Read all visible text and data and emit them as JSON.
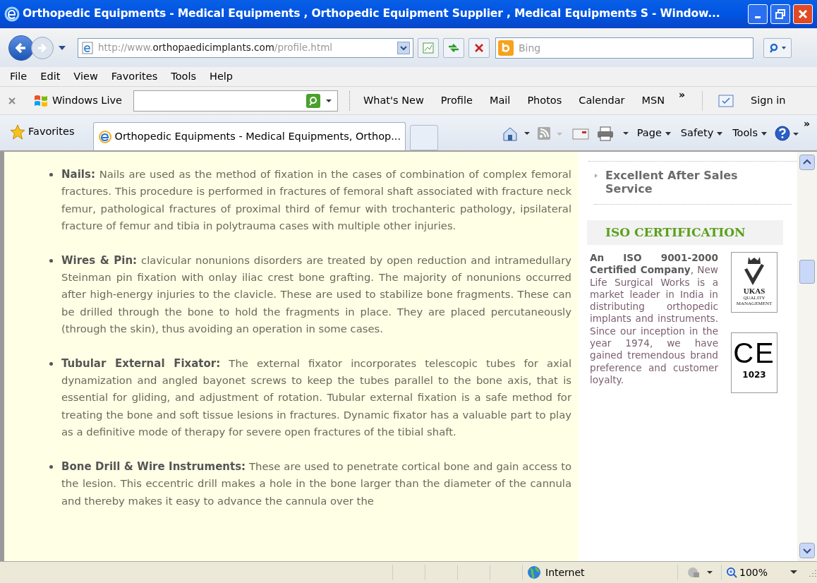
{
  "window": {
    "title": "Orthopedic Equipments - Medical Equipments , Orthopedic Equipment Supplier , Medical Equipments S - Window..."
  },
  "address": {
    "prefix": "http://www.",
    "domain": "orthopaedicimplants.com",
    "path": "/profile.html"
  },
  "search": {
    "placeholder": "Bing"
  },
  "menu": [
    "File",
    "Edit",
    "View",
    "Favorites",
    "Tools",
    "Help"
  ],
  "links_toolbar": {
    "brand": "Windows Live",
    "links": [
      "What's New",
      "Profile",
      "Mail",
      "Photos",
      "Calendar",
      "MSN"
    ],
    "more": "»",
    "sign_in": "Sign in"
  },
  "favorites": "Favorites",
  "tabs": [
    {
      "label": "Orthopedic Equipments - Medical Equipments, Orthop...",
      "selected": true
    }
  ],
  "command_bar": [
    "Page",
    "Safety",
    "Tools"
  ],
  "command_more": "»",
  "content": {
    "items": [
      {
        "text": "**Nails:** Nails are used as the method of fixation in the cases of combination of complex femoral fractures. This procedure is performed in fractures of femoral shaft associated with fracture neck femur, pathological fractures of proximal third of femur with trochanteric pathology, ipsilateral fracture of femur and tibia in polytrauma cases with multiple other injuries."
      },
      {
        "text": "**Wires & Pin:** clavicular nonunions disorders are treated by open reduction and intramedullary Steinman pin fixation with onlay iliac crest bone grafting. The majority of nonunions occurred after high-energy injuries to the clavicle. These are used to stabilize bone fragments. These can be drilled through the bone to hold the fragments in place. They are placed percutaneously (through the skin), thus avoiding an operation in some cases."
      },
      {
        "text": "**Tubular External Fixator:** The external fixator incorporates telescopic tubes for axial dynamization and angled bayonet screws to keep the tubes parallel to the bone axis, that is essential for gliding, and adjustment of rotation. Tubular external fixation is a safe method for treating the bone and soft tissue lesions in fractures. Dynamic fixator has a valuable part to play as a definitive mode of therapy for severe open fractures of the tibial shaft."
      },
      {
        "text": "**Bone Drill & Wire Instruments:** These are used to penetrate cortical bone and gain access to the lesion. This eccentric drill makes a hole in the bone larger than the diameter of the cannula and thereby makes it easy to advance the cannula over the"
      }
    ]
  },
  "sidebar": {
    "feature": "Excellent After Sales Service",
    "heading": "ISO CERTIFICATION",
    "text": "**An ISO 9001-2000 Certified Company**, New Life Surgical Works is a market leader in India in distributing orthopedic implants and instruments. Since our inception in the year 1974, we have gained tremendous brand preference and customer loyalty.",
    "ukas": {
      "name": "UKAS",
      "caption": "QUALITY MANAGEMENT"
    },
    "ce": {
      "mark": "CE",
      "number": "1023"
    }
  },
  "status_bar": {
    "zone": "Internet",
    "zoom": "100%"
  }
}
